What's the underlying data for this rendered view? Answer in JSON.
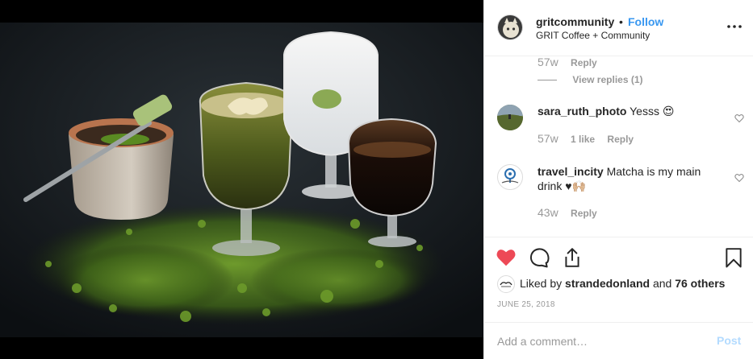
{
  "post": {
    "username": "gritcommunity",
    "dot": "•",
    "follow_label": "Follow",
    "location": "GRIT Coffee + Community",
    "more_icon": "more-horizontal-icon"
  },
  "comments": {
    "thread_meta": {
      "age": "57w",
      "reply": "Reply"
    },
    "view_replies": "View replies (1)",
    "items": [
      {
        "username": "sara_ruth_photo",
        "text": "Yesss 😍",
        "age": "57w",
        "likes": "1 like",
        "reply": "Reply"
      },
      {
        "username": "travel_incity",
        "text": "Matcha is my main drink ♥🙌🏼",
        "age": "43w",
        "reply": "Reply"
      }
    ]
  },
  "actions": {
    "like_icon": "heart-filled-icon",
    "comment_icon": "comment-icon",
    "share_icon": "share-icon",
    "save_icon": "bookmark-icon",
    "like_color": "#ed4956"
  },
  "likes": {
    "prefix": "Liked by ",
    "user": "strandedonland",
    "middle": " and ",
    "others": "76 others"
  },
  "date": "JUNE 25, 2018",
  "comment_box": {
    "placeholder": "Add a comment…",
    "post_label": "Post"
  },
  "colors": {
    "link": "#3897f0",
    "muted": "#999999",
    "post_disabled": "#b3dbff"
  }
}
